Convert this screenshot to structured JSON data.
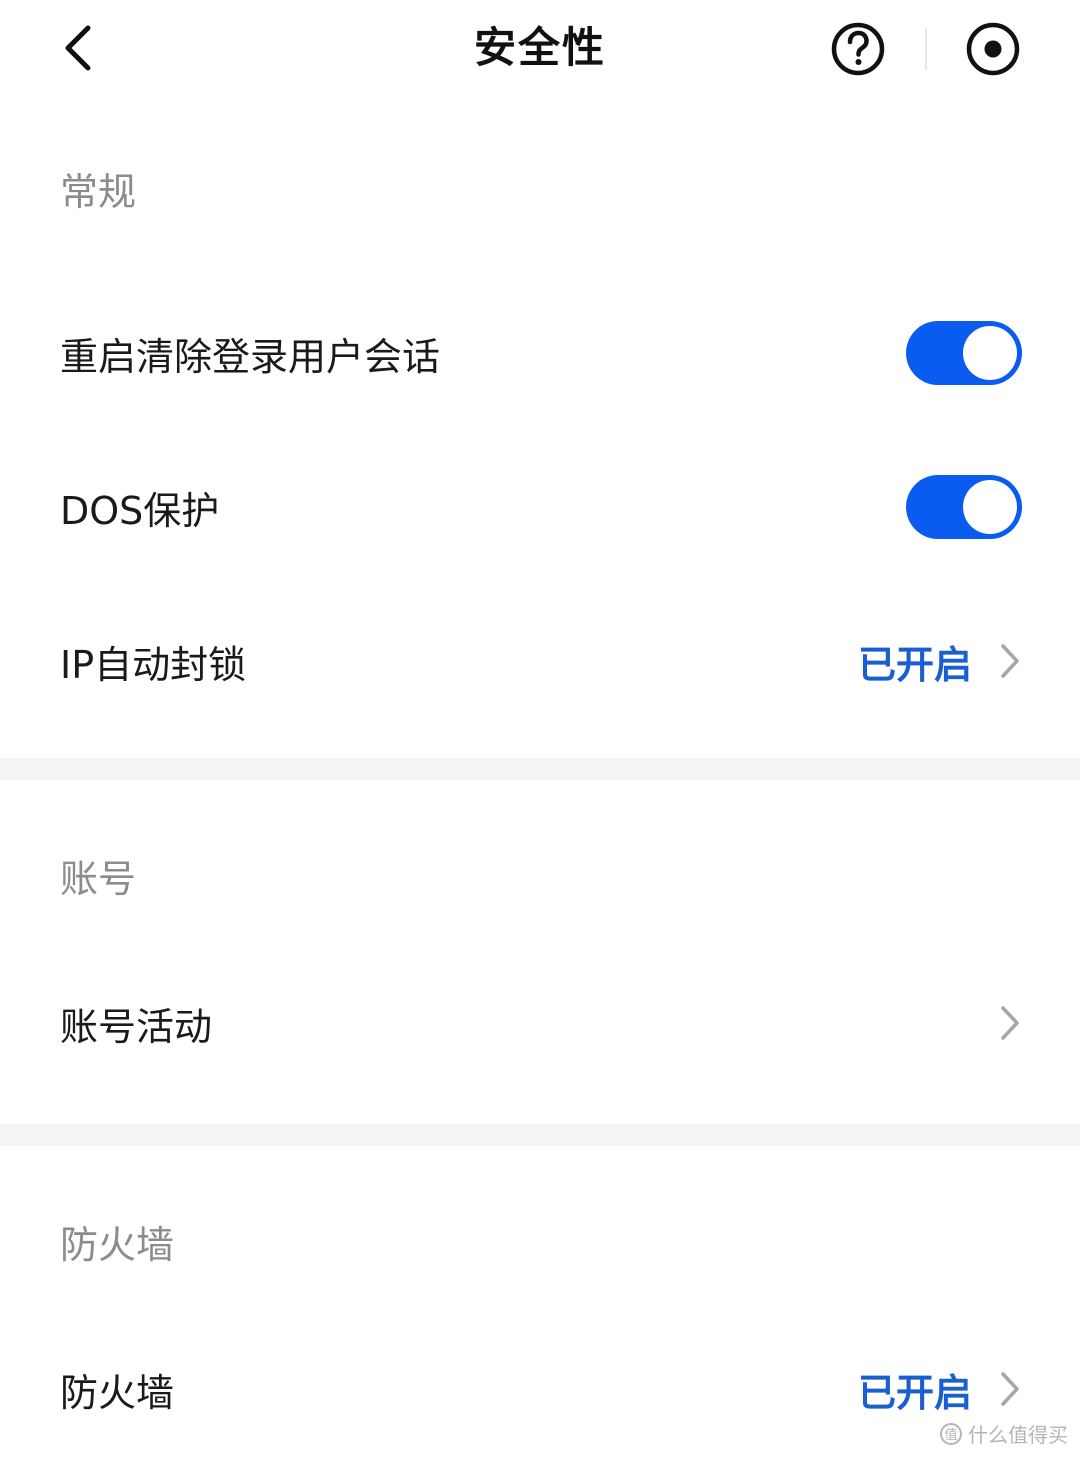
{
  "header": {
    "title": "安全性"
  },
  "sections": {
    "general": {
      "title": "常规",
      "items": [
        {
          "label": "重启清除登录用户会话",
          "toggle": "on"
        },
        {
          "label": "DOS保护",
          "toggle": "on"
        },
        {
          "label": "IP自动封锁",
          "value": "已开启"
        }
      ]
    },
    "account": {
      "title": "账号",
      "items": [
        {
          "label": "账号活动"
        }
      ]
    },
    "firewall": {
      "title": "防火墙",
      "items": [
        {
          "label": "防火墙",
          "value": "已开启"
        }
      ]
    }
  },
  "colors": {
    "accent": "#0a5cf0",
    "value_text": "#1a5fd0",
    "section_title": "#8c8c8c",
    "gap_background": "#f4f4f4"
  },
  "icons": {
    "back": "chevron-left-icon",
    "help": "question-circle-icon",
    "record": "record-circle-icon",
    "row_arrow": "chevron-right-icon"
  },
  "watermark": {
    "text": "什么值得买",
    "badge": "值"
  }
}
